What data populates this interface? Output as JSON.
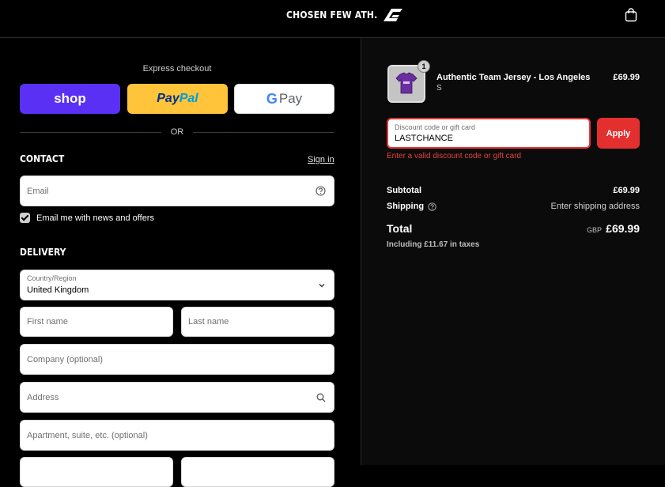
{
  "header": {
    "brand": "CHOSEN FEW ATH.",
    "cart_icon": "shopping-bag-icon"
  },
  "express": {
    "label": "Express checkout",
    "shop": "shop",
    "paypal_a": "Pay",
    "paypal_b": "Pal",
    "gpay_g": "G",
    "gpay_rest": "Pay",
    "or": "OR"
  },
  "contact": {
    "title": "CONTACT",
    "signin": "Sign in",
    "email_placeholder": "Email",
    "newsletter_label": "Email me with news and offers",
    "newsletter_checked": true
  },
  "delivery": {
    "title": "DELIVERY",
    "country_label": "Country/Region",
    "country_value": "United Kingdom",
    "first_name": "First name",
    "last_name": "Last name",
    "company": "Company (optional)",
    "address": "Address",
    "apartment": "Apartment, suite, etc. (optional)"
  },
  "order": {
    "item": {
      "name": "Authentic Team Jersey - Los Angeles",
      "variant": "S",
      "price": "£69.99",
      "quantity": "1"
    },
    "discount": {
      "label": "Discount code or gift card",
      "value": "LASTCHANCE",
      "apply": "Apply",
      "error": "Enter a valid discount code or gift card"
    },
    "subtotal_label": "Subtotal",
    "subtotal_value": "£69.99",
    "shipping_label": "Shipping",
    "shipping_value": "Enter shipping address",
    "total_label": "Total",
    "currency": "GBP",
    "total_value": "£69.99",
    "tax_line": "Including £11.67 in taxes"
  },
  "colors": {
    "accent_red": "#e42f2f",
    "shop_purple": "#5a31f4",
    "paypal_yellow": "#ffc439"
  }
}
